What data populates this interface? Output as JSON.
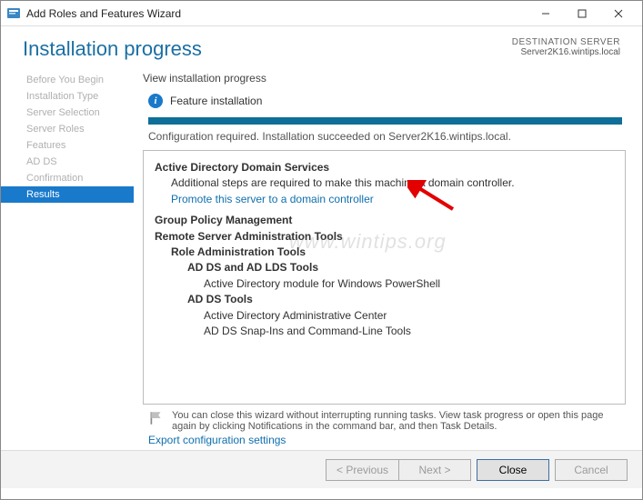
{
  "titlebar": {
    "title": "Add Roles and Features Wizard"
  },
  "header": {
    "heading": "Installation progress",
    "dest_label": "DESTINATION SERVER",
    "dest_value": "Server2K16.wintips.local"
  },
  "sidebar": {
    "items": [
      "Before You Begin",
      "Installation Type",
      "Server Selection",
      "Server Roles",
      "Features",
      "AD DS",
      "Confirmation",
      "Results"
    ],
    "active_index": 7
  },
  "content": {
    "view_label": "View installation progress",
    "status_title": "Feature installation",
    "status_msg": "Configuration required. Installation succeeded on Server2K16.wintips.local.",
    "adds_title": "Active Directory Domain Services",
    "adds_note": "Additional steps are required to make this machine a domain controller.",
    "promote_link": "Promote this server to a domain controller",
    "gpm": "Group Policy Management",
    "rsat": "Remote Server Administration Tools",
    "rat": "Role Administration Tools",
    "adlds": "AD DS and AD LDS Tools",
    "admod": "Active Directory module for Windows PowerShell",
    "addstools": "AD DS Tools",
    "adac": "Active Directory Administrative Center",
    "snapins": "AD DS Snap-Ins and Command-Line Tools",
    "close_note": "You can close this wizard without interrupting running tasks. View task progress or open this page again by clicking Notifications in the command bar, and then Task Details.",
    "export_link": "Export configuration settings",
    "watermark": "www.wintips.org"
  },
  "footer": {
    "previous": "< Previous",
    "next": "Next >",
    "close": "Close",
    "cancel": "Cancel"
  }
}
